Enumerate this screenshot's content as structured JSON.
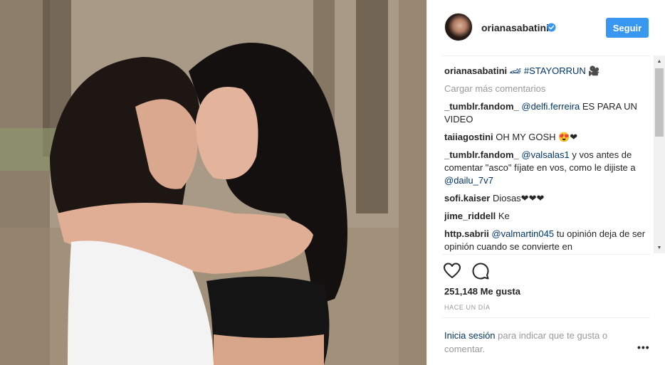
{
  "photo": {
    "alt": ""
  },
  "header": {
    "username": "orianasabatini",
    "verified": true,
    "follow_label": "Seguir"
  },
  "comments": {
    "caption": {
      "user": "orianasabatini",
      "text": "🏎 #STAYORRUN 🎥"
    },
    "load_more": "Cargar más comentarios",
    "items": [
      {
        "user": "_tumblr.fandom_",
        "mention": "@delfi.ferreira",
        "text": " ES PARA UN VIDEO"
      },
      {
        "user": "taiiagostini",
        "mention": "",
        "text": " OH MY GOSH 😍❤"
      },
      {
        "user": "_tumblr.fandom_",
        "mention": "@valsalas1",
        "text": " y vos antes de comentar \"asco\" fíjate en vos, como le dijiste a ",
        "mention2": "@dailu_7v7"
      },
      {
        "user": "sofi.kaiser",
        "mention": "",
        "text": " Diosas❤❤❤"
      },
      {
        "user": "jime_riddell",
        "mention": "",
        "text": " Ke"
      },
      {
        "user": "http.sabrii",
        "mention": "@valmartin045",
        "text": " tu opinión deja de ser opinión cuando se convierte en"
      }
    ]
  },
  "stats": {
    "likes": "251,148 Me gusta",
    "time": "HACE UN DÍA"
  },
  "footer": {
    "login_link": "Inicia sesión",
    "login_text": " para indicar que te gusta o comentar.",
    "more": "•••"
  },
  "icons": {
    "like": "heart-outline-icon",
    "comment": "comment-bubble-icon",
    "verified": "verified-badge-icon"
  },
  "colors": {
    "accent": "#3897f0",
    "link": "#003569",
    "muted": "#999999"
  }
}
